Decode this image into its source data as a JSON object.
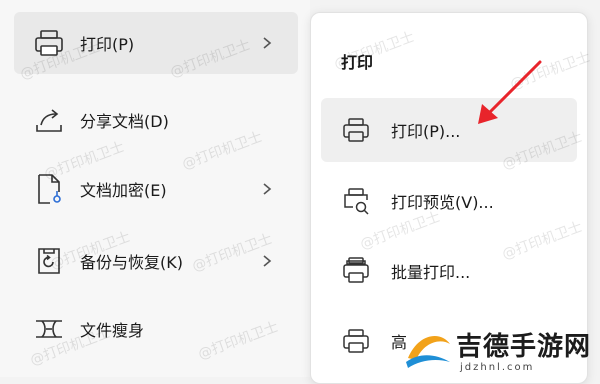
{
  "left_menu": {
    "items": [
      {
        "label": "打印(P)",
        "has_submenu": true,
        "active": true,
        "icon": "printer-icon"
      },
      {
        "label": "分享文档(D)",
        "has_submenu": false,
        "icon": "share-icon"
      },
      {
        "label": "文档加密(E)",
        "has_submenu": true,
        "icon": "document-lock-icon"
      },
      {
        "label": "备份与恢复(K)",
        "has_submenu": true,
        "icon": "backup-restore-icon"
      },
      {
        "label": "文件瘦身",
        "has_submenu": false,
        "icon": "file-slim-icon"
      }
    ]
  },
  "submenu": {
    "title": "打印",
    "items": [
      {
        "label": "打印(P)...",
        "active": true,
        "icon": "printer-icon"
      },
      {
        "label": "打印预览(V)...",
        "icon": "print-preview-icon"
      },
      {
        "label": "批量打印...",
        "icon": "batch-print-icon"
      },
      {
        "label": "高",
        "icon": "advanced-print-icon"
      }
    ]
  },
  "watermark": {
    "text": "@打印机卫士"
  },
  "annotation": {
    "arrow_color": "#e8242b"
  },
  "brand": {
    "name": "吉德手游网",
    "sub": "jdzhnl.com"
  },
  "colors": {
    "active_bg": "#e9e9e9",
    "accent": "#e8242b"
  }
}
